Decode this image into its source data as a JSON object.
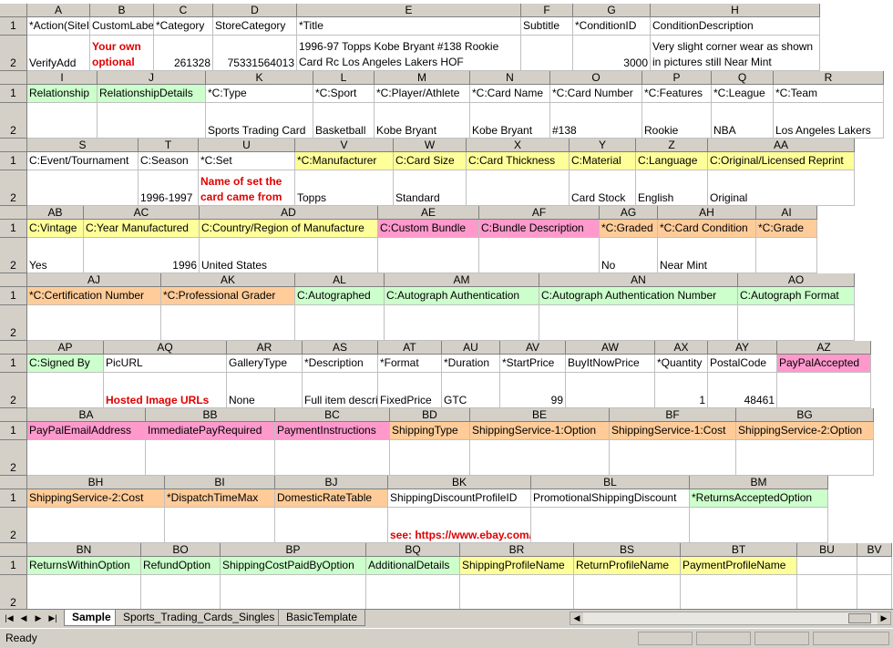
{
  "sheet_tabs": [
    "Sample",
    "Sports_Trading_Cards_Singles",
    "BasicTemplate"
  ],
  "active_tab": "Sample",
  "status": "Ready",
  "row_labels": [
    "1",
    "2"
  ],
  "blocks": [
    {
      "cols": [
        {
          "letter": "A",
          "header": "*Action(SiteID=US",
          "value": "VerifyAdd",
          "hcolor": "",
          "vstyle": ""
        },
        {
          "letter": "B",
          "header": "CustomLabel",
          "value": "Your own optional inventory number",
          "hcolor": "",
          "vstyle": "red-wrap"
        },
        {
          "letter": "C",
          "header": "*Category",
          "value": "261328",
          "hcolor": "",
          "vstyle": "num"
        },
        {
          "letter": "D",
          "header": "StoreCategory",
          "value": "75331564013",
          "hcolor": "",
          "vstyle": "num"
        },
        {
          "letter": "E",
          "header": "*Title",
          "value": "1996-97 Topps Kobe Bryant #138 Rookie Card Rc Los Angeles Lakers HOF",
          "hcolor": "",
          "vstyle": "wrap"
        },
        {
          "letter": "F",
          "header": "Subtitle",
          "value": "",
          "hcolor": "",
          "vstyle": ""
        },
        {
          "letter": "G",
          "header": "*ConditionID",
          "value": "3000",
          "hcolor": "",
          "vstyle": "num"
        },
        {
          "letter": "H",
          "header": "ConditionDescription",
          "value": "Very slight corner wear as shown in pictures still Near Mint",
          "hcolor": "",
          "vstyle": "wrap"
        }
      ]
    },
    {
      "cols": [
        {
          "letter": "I",
          "header": "Relationship",
          "value": "",
          "hcolor": "green",
          "vstyle": ""
        },
        {
          "letter": "J",
          "header": "RelationshipDetails",
          "value": "",
          "hcolor": "green",
          "vstyle": ""
        },
        {
          "letter": "K",
          "header": "*C:Type",
          "value": "Sports Trading Card",
          "hcolor": "",
          "vstyle": ""
        },
        {
          "letter": "L",
          "header": "*C:Sport",
          "value": "Basketball",
          "hcolor": "",
          "vstyle": ""
        },
        {
          "letter": "M",
          "header": "*C:Player/Athlete",
          "value": "Kobe Bryant",
          "hcolor": "",
          "vstyle": ""
        },
        {
          "letter": "N",
          "header": "*C:Card Name",
          "value": "Kobe Bryant",
          "hcolor": "",
          "vstyle": ""
        },
        {
          "letter": "O",
          "header": "*C:Card Number",
          "value": "#138",
          "hcolor": "",
          "vstyle": ""
        },
        {
          "letter": "P",
          "header": "*C:Features",
          "value": "Rookie",
          "hcolor": "",
          "vstyle": ""
        },
        {
          "letter": "Q",
          "header": "*C:League",
          "value": "NBA",
          "hcolor": "",
          "vstyle": ""
        },
        {
          "letter": "R",
          "header": "*C:Team",
          "value": "Los Angeles Lakers",
          "hcolor": "",
          "vstyle": ""
        }
      ]
    },
    {
      "cols": [
        {
          "letter": "S",
          "header": "C:Event/Tournament",
          "value": "",
          "hcolor": "",
          "vstyle": ""
        },
        {
          "letter": "T",
          "header": "C:Season",
          "value": "1996-1997",
          "hcolor": "",
          "vstyle": ""
        },
        {
          "letter": "U",
          "header": "*C:Set",
          "value": "Name of set the card came from",
          "hcolor": "",
          "vstyle": "red-wrap"
        },
        {
          "letter": "V",
          "header": "*C:Manufacturer",
          "value": "Topps",
          "hcolor": "yellow",
          "vstyle": ""
        },
        {
          "letter": "W",
          "header": "C:Card Size",
          "value": "Standard",
          "hcolor": "yellow",
          "vstyle": ""
        },
        {
          "letter": "X",
          "header": "C:Card Thickness",
          "value": "",
          "hcolor": "yellow",
          "vstyle": ""
        },
        {
          "letter": "Y",
          "header": "C:Material",
          "value": "Card Stock",
          "hcolor": "yellow",
          "vstyle": ""
        },
        {
          "letter": "Z",
          "header": "C:Language",
          "value": "English",
          "hcolor": "yellow",
          "vstyle": ""
        },
        {
          "letter": "AA",
          "header": "C:Original/Licensed Reprint",
          "value": "Original",
          "hcolor": "yellow",
          "vstyle": ""
        }
      ]
    },
    {
      "cols": [
        {
          "letter": "AB",
          "header": "C:Vintage",
          "value": "Yes",
          "hcolor": "yellow",
          "vstyle": ""
        },
        {
          "letter": "AC",
          "header": "C:Year Manufactured",
          "value": "1996",
          "hcolor": "yellow",
          "vstyle": "num"
        },
        {
          "letter": "AD",
          "header": "C:Country/Region of Manufacture",
          "value": "United States",
          "hcolor": "yellow",
          "vstyle": ""
        },
        {
          "letter": "AE",
          "header": "C:Custom Bundle",
          "value": "",
          "hcolor": "pink",
          "vstyle": ""
        },
        {
          "letter": "AF",
          "header": "C:Bundle Description",
          "value": "",
          "hcolor": "pink",
          "vstyle": ""
        },
        {
          "letter": "AG",
          "header": "*C:Graded",
          "value": "No",
          "hcolor": "orange",
          "vstyle": ""
        },
        {
          "letter": "AH",
          "header": "*C:Card Condition",
          "value": "Near Mint",
          "hcolor": "orange",
          "vstyle": ""
        },
        {
          "letter": "AI",
          "header": "*C:Grade",
          "value": "",
          "hcolor": "orange",
          "vstyle": ""
        }
      ]
    },
    {
      "cols": [
        {
          "letter": "AJ",
          "header": "*C:Certification Number",
          "value": "",
          "hcolor": "orange",
          "vstyle": ""
        },
        {
          "letter": "AK",
          "header": "*C:Professional Grader",
          "value": "",
          "hcolor": "orange",
          "vstyle": ""
        },
        {
          "letter": "AL",
          "header": "C:Autographed",
          "value": "",
          "hcolor": "green",
          "vstyle": ""
        },
        {
          "letter": "AM",
          "header": "C:Autograph Authentication",
          "value": "",
          "hcolor": "green",
          "vstyle": ""
        },
        {
          "letter": "AN",
          "header": "C:Autograph Authentication Number",
          "value": "",
          "hcolor": "green",
          "vstyle": ""
        },
        {
          "letter": "AO",
          "header": "C:Autograph Format",
          "value": "",
          "hcolor": "green",
          "vstyle": ""
        }
      ]
    },
    {
      "cols": [
        {
          "letter": "AP",
          "header": "C:Signed By",
          "value": "",
          "hcolor": "green",
          "vstyle": ""
        },
        {
          "letter": "AQ",
          "header": "PicURL",
          "value": "Hosted Image URLs",
          "hcolor": "",
          "vstyle": "red"
        },
        {
          "letter": "AR",
          "header": "GalleryType",
          "value": "None",
          "hcolor": "",
          "vstyle": ""
        },
        {
          "letter": "AS",
          "header": "*Description",
          "value": "Full item description",
          "hcolor": "",
          "vstyle": ""
        },
        {
          "letter": "AT",
          "header": "*Format",
          "value": "FixedPrice",
          "hcolor": "",
          "vstyle": ""
        },
        {
          "letter": "AU",
          "header": "*Duration",
          "value": "GTC",
          "hcolor": "",
          "vstyle": ""
        },
        {
          "letter": "AV",
          "header": "*StartPrice",
          "value": "99",
          "hcolor": "",
          "vstyle": "num"
        },
        {
          "letter": "AW",
          "header": "BuyItNowPrice",
          "value": "",
          "hcolor": "",
          "vstyle": ""
        },
        {
          "letter": "AX",
          "header": "*Quantity",
          "value": "1",
          "hcolor": "",
          "vstyle": "num"
        },
        {
          "letter": "AY",
          "header": "PostalCode",
          "value": "48461",
          "hcolor": "",
          "vstyle": "num"
        },
        {
          "letter": "AZ",
          "header": "PayPalAccepted",
          "value": "",
          "hcolor": "pink",
          "vstyle": ""
        }
      ]
    },
    {
      "cols": [
        {
          "letter": "BA",
          "header": "PayPalEmailAddress",
          "value": "",
          "hcolor": "pink",
          "vstyle": ""
        },
        {
          "letter": "BB",
          "header": "ImmediatePayRequired",
          "value": "",
          "hcolor": "pink",
          "vstyle": ""
        },
        {
          "letter": "BC",
          "header": "PaymentInstructions",
          "value": "",
          "hcolor": "pink",
          "vstyle": ""
        },
        {
          "letter": "BD",
          "header": "ShippingType",
          "value": "",
          "hcolor": "orange",
          "vstyle": ""
        },
        {
          "letter": "BE",
          "header": "ShippingService-1:Option",
          "value": "",
          "hcolor": "orange",
          "vstyle": ""
        },
        {
          "letter": "BF",
          "header": "ShippingService-1:Cost",
          "value": "",
          "hcolor": "orange",
          "vstyle": ""
        },
        {
          "letter": "BG",
          "header": "ShippingService-2:Option",
          "value": "",
          "hcolor": "orange",
          "vstyle": ""
        }
      ]
    },
    {
      "cols": [
        {
          "letter": "BH",
          "header": "ShippingService-2:Cost",
          "value": "",
          "hcolor": "orange",
          "vstyle": ""
        },
        {
          "letter": "BI",
          "header": "*DispatchTimeMax",
          "value": "",
          "hcolor": "orange",
          "vstyle": ""
        },
        {
          "letter": "BJ",
          "header": "DomesticRateTable",
          "value": "",
          "hcolor": "orange",
          "vstyle": ""
        },
        {
          "letter": "BK",
          "header": "ShippingDiscountProfileID",
          "value": "see: https://www.ebay.com/ship/prf",
          "hcolor": "",
          "vstyle": "red"
        },
        {
          "letter": "BL",
          "header": "PromotionalShippingDiscount",
          "value": "",
          "hcolor": "",
          "vstyle": ""
        },
        {
          "letter": "BM",
          "header": "*ReturnsAcceptedOption",
          "value": "",
          "hcolor": "green",
          "vstyle": ""
        }
      ]
    },
    {
      "cols": [
        {
          "letter": "BN",
          "header": "ReturnsWithinOption",
          "value": "",
          "hcolor": "green",
          "vstyle": ""
        },
        {
          "letter": "BO",
          "header": "RefundOption",
          "value": "",
          "hcolor": "green",
          "vstyle": ""
        },
        {
          "letter": "BP",
          "header": "ShippingCostPaidByOption",
          "value": "",
          "hcolor": "green",
          "vstyle": ""
        },
        {
          "letter": "BQ",
          "header": "AdditionalDetails",
          "value": "",
          "hcolor": "green",
          "vstyle": ""
        },
        {
          "letter": "BR",
          "header": "ShippingProfileName",
          "value": "",
          "hcolor": "yellow",
          "vstyle": ""
        },
        {
          "letter": "BS",
          "header": "ReturnProfileName",
          "value": "",
          "hcolor": "yellow",
          "vstyle": ""
        },
        {
          "letter": "BT",
          "header": "PaymentProfileName",
          "value": "",
          "hcolor": "yellow",
          "vstyle": ""
        },
        {
          "letter": "BU",
          "header": "",
          "value": "",
          "hcolor": "",
          "vstyle": ""
        },
        {
          "letter": "BV",
          "header": "",
          "value": "",
          "hcolor": "",
          "vstyle": ""
        }
      ]
    }
  ]
}
